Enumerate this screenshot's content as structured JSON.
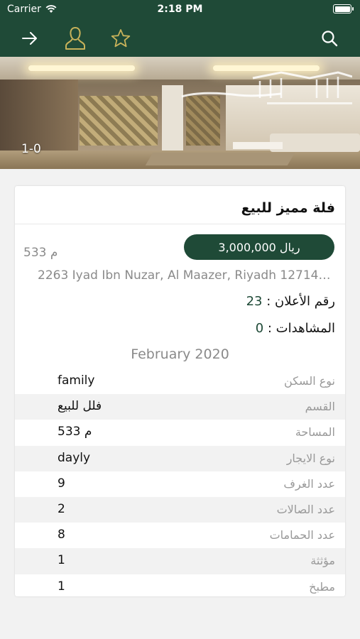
{
  "status_bar": {
    "carrier": "Carrier",
    "time": "2:18 PM"
  },
  "nav": {
    "icons": [
      "arrow-right-icon",
      "user-icon",
      "star-icon",
      "search-icon"
    ],
    "accent_color": "#1f4a37",
    "icon_gold": "#c8b25a"
  },
  "gallery": {
    "counter": "1-0"
  },
  "listing": {
    "title": "فلة مميز للبيع",
    "price": "3,000,000 ريال",
    "area": "533 م",
    "address": "2263 Iyad Ibn Nuzar, Al Maazer, Riyadh 12714…",
    "ad_number_label": "رقم الأعلان : ",
    "ad_number": "23",
    "views_label": "المشاهدات : ",
    "views": "0",
    "date": "February 2020"
  },
  "specs": [
    {
      "label": "نوع السكن",
      "value": "family"
    },
    {
      "label": "القسم",
      "value": "فلل للبيع"
    },
    {
      "label": "المساحة",
      "value": "533 م"
    },
    {
      "label": "نوع الايجار",
      "value": "dayly"
    },
    {
      "label": "عدد الغرف",
      "value": "9"
    },
    {
      "label": "عدد الصالات",
      "value": "2"
    },
    {
      "label": "عدد الحمامات",
      "value": "8"
    },
    {
      "label": "مؤثثة",
      "value": "1"
    },
    {
      "label": "مطبخ",
      "value": "1"
    }
  ]
}
